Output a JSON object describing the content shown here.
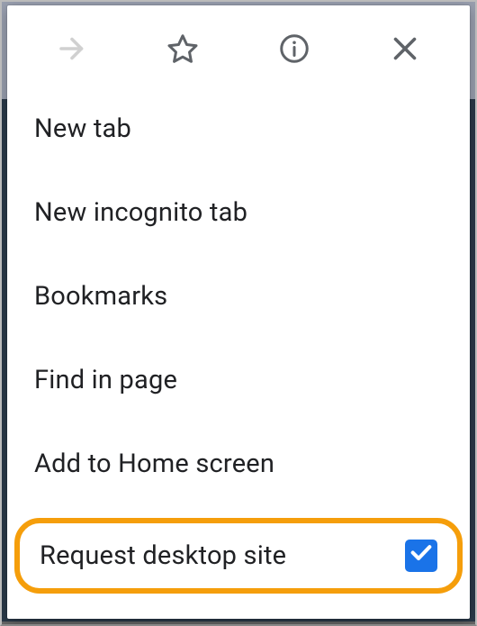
{
  "iconRow": {
    "forward": "forward",
    "star": "star",
    "info": "info",
    "close": "close"
  },
  "menu": {
    "newTab": "New tab",
    "newIncognito": "New incognito tab",
    "bookmarks": "Bookmarks",
    "findInPage": "Find in page",
    "addToHome": "Add to Home screen",
    "requestDesktop": {
      "label": "Request desktop site",
      "checked": true
    }
  },
  "colors": {
    "highlight": "#f59e0b",
    "checkbox": "#1a73e8"
  }
}
